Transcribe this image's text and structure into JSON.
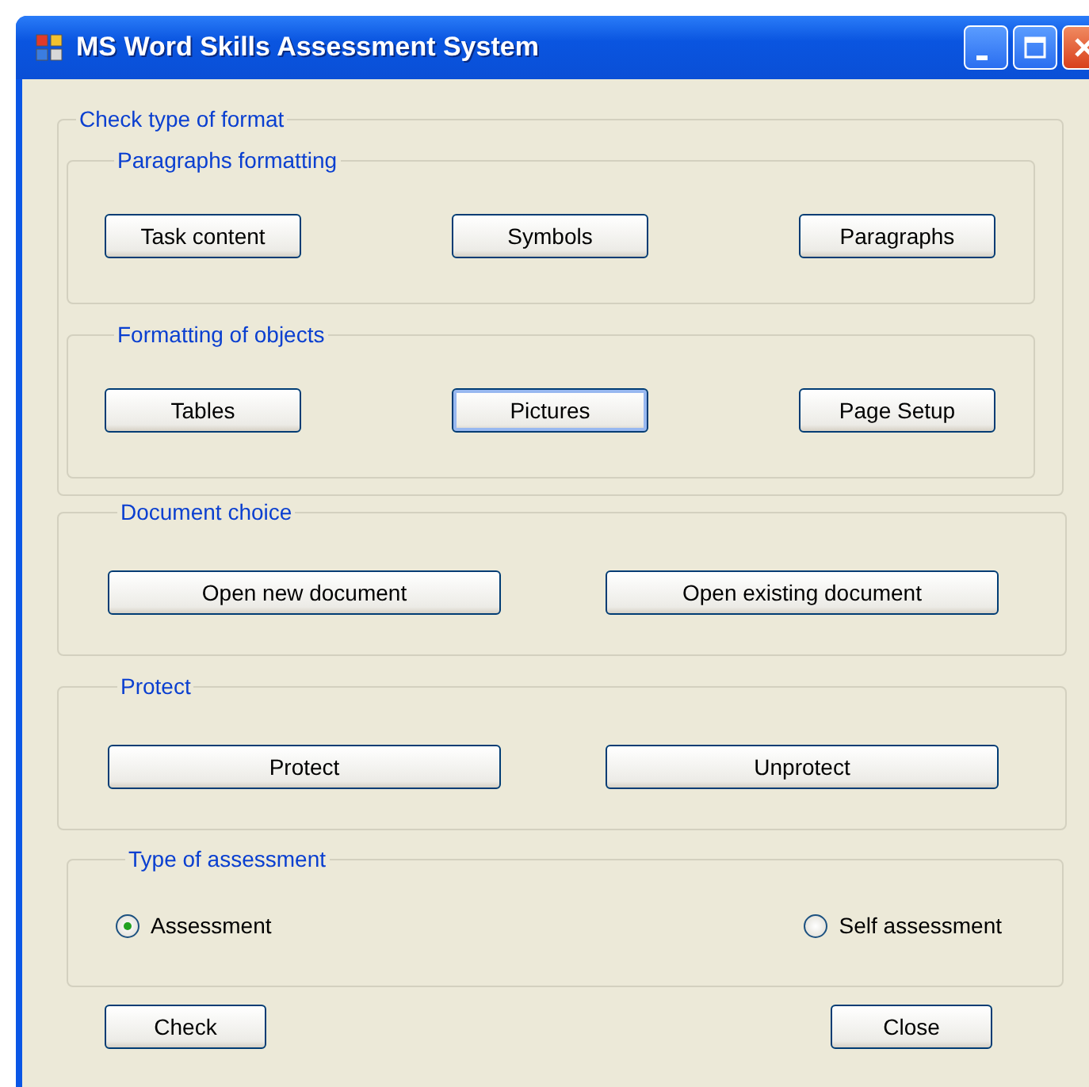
{
  "window": {
    "title": "MS Word Skills Assessment System"
  },
  "format_group": {
    "title": "Check type of format",
    "subgroups": [
      {
        "title": "Paragraphs formatting",
        "buttons": [
          {
            "label": "Task content",
            "focused": false
          },
          {
            "label": "Symbols",
            "focused": false
          },
          {
            "label": "Paragraphs",
            "focused": false
          }
        ]
      },
      {
        "title": "Formatting of objects",
        "buttons": [
          {
            "label": "Tables",
            "focused": false
          },
          {
            "label": "Pictures",
            "focused": true
          },
          {
            "label": "Page Setup",
            "focused": false
          }
        ]
      }
    ]
  },
  "groups": [
    {
      "title": "Document choice",
      "buttons": [
        {
          "label": "Open new document",
          "focused": false
        },
        {
          "label": "Open existing document",
          "focused": false
        }
      ]
    },
    {
      "title": "Protect",
      "buttons": [
        {
          "label": "Protect",
          "focused": false
        },
        {
          "label": "Unprotect",
          "focused": false
        }
      ]
    }
  ],
  "assessment_group": {
    "title": "Type of assessment",
    "options": [
      {
        "label": "Assessment",
        "selected": true
      },
      {
        "label": "Self assessment",
        "selected": false
      }
    ]
  },
  "footer_buttons": [
    {
      "label": "Check",
      "focused": false
    },
    {
      "label": "Close",
      "focused": false
    }
  ]
}
